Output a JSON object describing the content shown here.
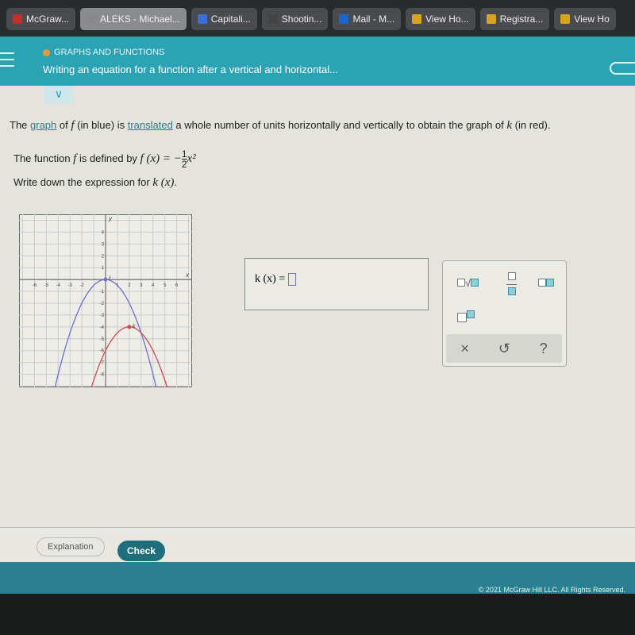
{
  "browser_tabs": [
    {
      "label": "McGraw...",
      "icon": "mcgraw-icon",
      "color": "#c0302b",
      "active": false
    },
    {
      "label": "ALEKS - Michael...",
      "icon": "aleks-icon",
      "color": "#888",
      "active": true
    },
    {
      "label": "Capitali...",
      "icon": "docs-icon",
      "color": "#3b6fd8",
      "active": false
    },
    {
      "label": "Shootin...",
      "icon": "person-icon",
      "color": "#444",
      "active": false
    },
    {
      "label": "Mail - M...",
      "icon": "outlook-icon",
      "color": "#1d66c5",
      "active": false
    },
    {
      "label": "View Ho...",
      "icon": "star-icon",
      "color": "#d9a520",
      "active": false
    },
    {
      "label": "Registra...",
      "icon": "star-icon",
      "color": "#d9a520",
      "active": false
    },
    {
      "label": "View Ho",
      "icon": "star-icon",
      "color": "#d9a520",
      "active": false
    }
  ],
  "header": {
    "category": "GRAPHS AND FUNCTIONS",
    "title": "Writing an equation for a function after a vertical and horizontal..."
  },
  "question": {
    "p1_a": "The ",
    "link1": "graph",
    "p1_b": " of ",
    "f": "f",
    "p1_c": " (in blue) is ",
    "link2": "translated",
    "p1_d": " a whole number of units horizontally and vertically to obtain the graph of ",
    "k": "k",
    "p1_e": " (in red).",
    "p2_a": "The function ",
    "p2_b": " is defined by ",
    "fx": "f (x) = −",
    "num": "1",
    "den": "2",
    "x2": "x²",
    ".": ".",
    "p3": "Write down the expression for ",
    "kx": "k (x)",
    "p3_end": "."
  },
  "graph": {
    "xlabel": "x",
    "ylabel": "y",
    "xlim": [
      -7.3,
      7.3
    ],
    "ylim": [
      -9.1,
      5.5
    ],
    "x_ticks": [
      -6,
      -5,
      -4,
      -3,
      -2,
      1,
      2,
      3,
      4,
      5,
      6
    ],
    "y_ticks": [
      4,
      3,
      2,
      1,
      -1,
      -2,
      -3,
      -4,
      -5,
      -6,
      -7,
      -8
    ],
    "f": {
      "label": "f",
      "color": "#6a6fd8",
      "a": -0.5,
      "h": 0,
      "k": 0
    },
    "k": {
      "label": "k",
      "color": "#d04a4a",
      "a": -0.5,
      "h": 2,
      "k": -4
    }
  },
  "answer": {
    "label": "k (x) = ",
    "value": ""
  },
  "keypad": {
    "buttons": [
      "square-root",
      "fraction",
      "mixed-number",
      "exponent"
    ],
    "clear": "×",
    "undo": "↺",
    "help": "?"
  },
  "footer": {
    "explanation": "Explanation",
    "check": "Check",
    "copyright": "© 2021 McGraw Hill LLC. All Rights Reserved."
  }
}
